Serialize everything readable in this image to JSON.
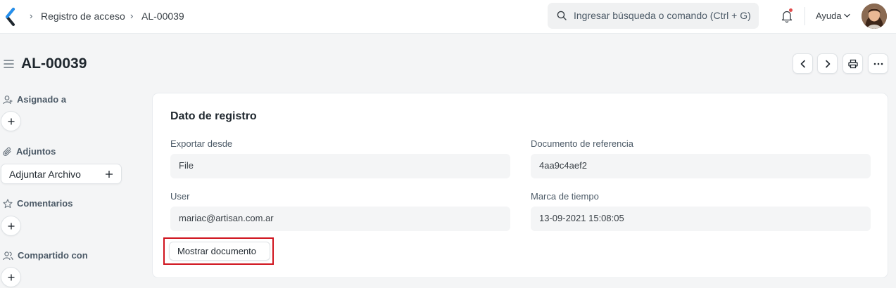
{
  "navbar": {
    "breadcrumbs": [
      "Registro de acceso",
      "AL-00039"
    ],
    "search_placeholder": "Ingresar búsqueda o comando (Ctrl + G)",
    "help_label": "Ayuda",
    "icons": [
      "app-logo-icon",
      "search-icon",
      "bell-icon",
      "chevron-down-icon",
      "avatar"
    ]
  },
  "page": {
    "title": "AL-00039",
    "toolbar_icons": [
      "chevron-left-icon",
      "chevron-right-icon",
      "printer-icon",
      "more-icon"
    ]
  },
  "sidebar": {
    "assigned_label": "Asignado a",
    "attachments_label": "Adjuntos",
    "attach_button": "Adjuntar Archivo",
    "comments_label": "Comentarios",
    "shared_label": "Compartido con"
  },
  "form": {
    "section_title": "Dato de registro",
    "fields": [
      {
        "label": "Exportar desde",
        "value": "File"
      },
      {
        "label": "Documento de referencia",
        "value": "4aa9c4aef2"
      },
      {
        "label": "User",
        "value": "mariac@artisan.com.ar"
      },
      {
        "label": "Marca de tiempo",
        "value": "13-09-2021 15:08:05"
      }
    ],
    "show_document_button": "Mostrar documento"
  },
  "colors": {
    "brand_logo": "#2490ef",
    "highlight_border": "#d0141e",
    "notification_dot": "#e24c4c"
  }
}
